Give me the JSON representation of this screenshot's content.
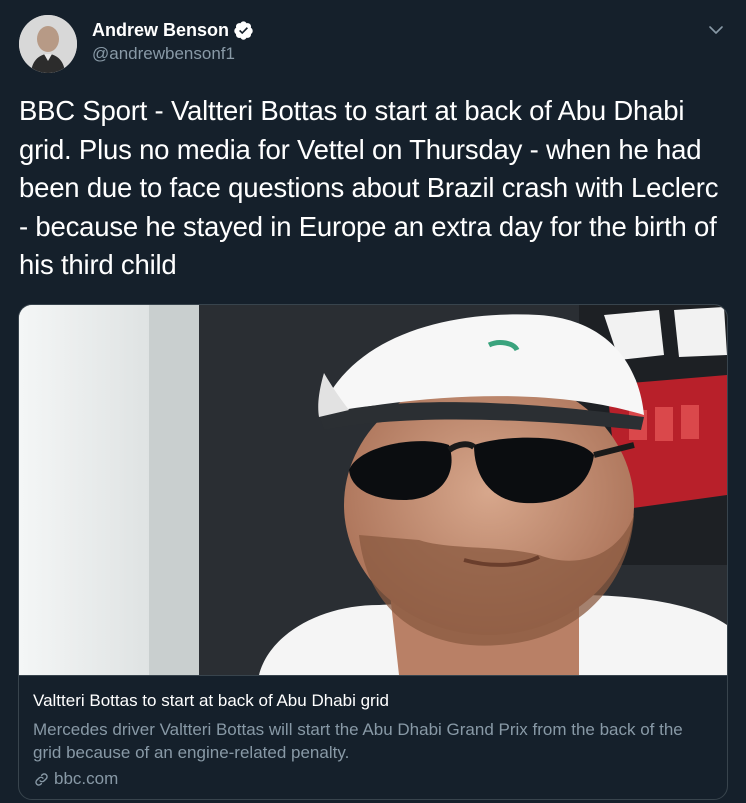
{
  "author": {
    "display_name": "Andrew Benson",
    "handle": "@andrewbensonf1",
    "verified": true,
    "avatar_icon": "person-avatar"
  },
  "menu_icon": "chevron-down-icon",
  "tweet": {
    "text": "BBC Sport - Valtteri Bottas to start at back of Abu Dhabi grid. Plus no media for Vettel on Thursday - when he had been due to face questions about Brazil crash with Leclerc - because he stayed in Europe an extra day for the birth of his third child"
  },
  "card": {
    "image_icon": "driver-photo",
    "title": "Valtteri Bottas to start at back of Abu Dhabi grid",
    "description": "Mercedes driver Valtteri Bottas will start the Abu Dhabi Grand Prix from the back of the grid because of an engine-related penalty.",
    "domain": "bbc.com",
    "domain_icon": "link-icon"
  },
  "colors": {
    "background": "#15202b",
    "text_primary": "#ffffff",
    "text_secondary": "#8899a6",
    "border": "#38444d",
    "verified_badge": "#ffffff"
  }
}
